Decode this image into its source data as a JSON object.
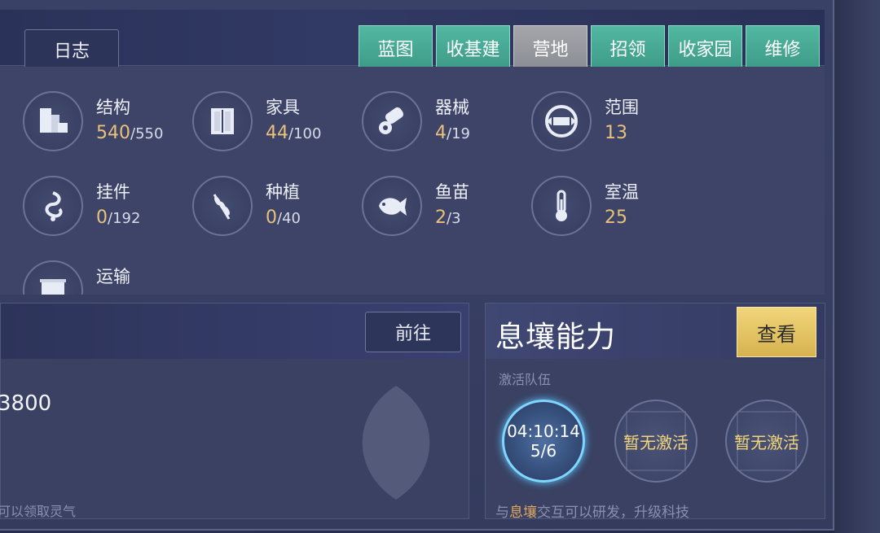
{
  "top": {
    "log_label": "日志",
    "tabs": [
      "蓝图",
      "收基建",
      "营地",
      "招领",
      "收家园",
      "维修"
    ],
    "active_tab": "营地"
  },
  "stats": [
    {
      "name": "结构",
      "value": "540",
      "max": "/550",
      "icon": "buildings-icon"
    },
    {
      "name": "家具",
      "value": "44",
      "max": "/100",
      "icon": "wardrobe-icon"
    },
    {
      "name": "器械",
      "value": "4",
      "max": "/19",
      "icon": "cannon-icon"
    },
    {
      "name": "范围",
      "value": "13",
      "max": "",
      "icon": "range-icon"
    },
    {
      "name": "挂件",
      "value": "0",
      "max": "/192",
      "icon": "dragon-ornament-icon"
    },
    {
      "name": "种植",
      "value": "0",
      "max": "/40",
      "icon": "wheat-icon"
    },
    {
      "name": "鱼苗",
      "value": "2",
      "max": "/3",
      "icon": "fish-icon"
    },
    {
      "name": "室温",
      "value": "25",
      "max": "",
      "icon": "thermometer-icon"
    },
    {
      "name": "运输",
      "value": "",
      "max": "",
      "icon": "cart-icon"
    }
  ],
  "left_panel": {
    "goto_label": "前往",
    "number": "3800",
    "hint": "可以领取灵气"
  },
  "right_panel": {
    "title": "息壤能力",
    "view_label": "查看",
    "sub": "激活队伍",
    "active_slot": {
      "time": "04:10:14",
      "count": "5/6"
    },
    "inactive_label": "暂无激活",
    "hint_prefix": "与",
    "hint_highlight": "息壤",
    "hint_suffix": "交互可以研发，升级科技"
  },
  "colors": {
    "tab": "#4aae98",
    "tab_active": "#9a9ca1",
    "accent_gold": "#e8c27a",
    "view_button": "#e6c463"
  }
}
